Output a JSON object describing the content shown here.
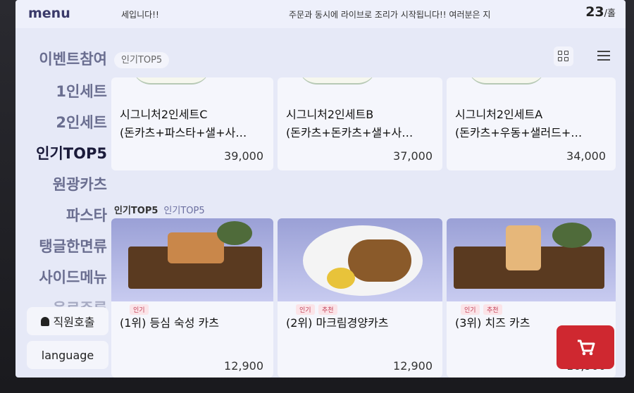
{
  "topbar": {
    "logo": "menu",
    "marquee_left": "세입니다!!",
    "marquee_right": "주문과 동시에 라이브로 조리가 시작됩니다!! 여러분은 지",
    "table_number": "23",
    "table_suffix": "/홀"
  },
  "sidebar": {
    "categories": [
      "이벤트참여",
      "1인세트",
      "2인세트",
      "인기TOP5",
      "원광카츠",
      "파스타",
      "탱글한면류",
      "사이드메뉴",
      "음료주류"
    ],
    "active": "인기TOP5",
    "staff_call": "직원호출",
    "language": "language"
  },
  "header": {
    "tab_label": "인기TOP5"
  },
  "set_menu": [
    {
      "name": "시그니처2인세트C",
      "desc": "(돈카츠+파스타+샐+사…",
      "price": "39,000"
    },
    {
      "name": "시그니처2인세트B",
      "desc": "(돈카츠+돈카츠+샐+사…",
      "price": "37,000"
    },
    {
      "name": "시그니처2인세트A",
      "desc": "(돈카츠+우동+샐러드+…",
      "price": "34,000"
    }
  ],
  "section": {
    "title": "인기TOP5",
    "subtitle": "인기TOP5"
  },
  "top5": [
    {
      "rank_name": "(1위) 등심 숙성 카츠",
      "badges": [
        "인기"
      ],
      "price": "12,900"
    },
    {
      "rank_name": "(2위) 마크림경양카츠",
      "badges": [
        "인기",
        "추천"
      ],
      "price": "12,900"
    },
    {
      "rank_name": "(3위) 치즈 카츠",
      "badges": [
        "인기",
        "추천"
      ],
      "price": "16,900"
    }
  ],
  "cart": {
    "icon": "cart-icon"
  },
  "colors": {
    "accent": "#cf2830",
    "badge": "#c23e55"
  }
}
